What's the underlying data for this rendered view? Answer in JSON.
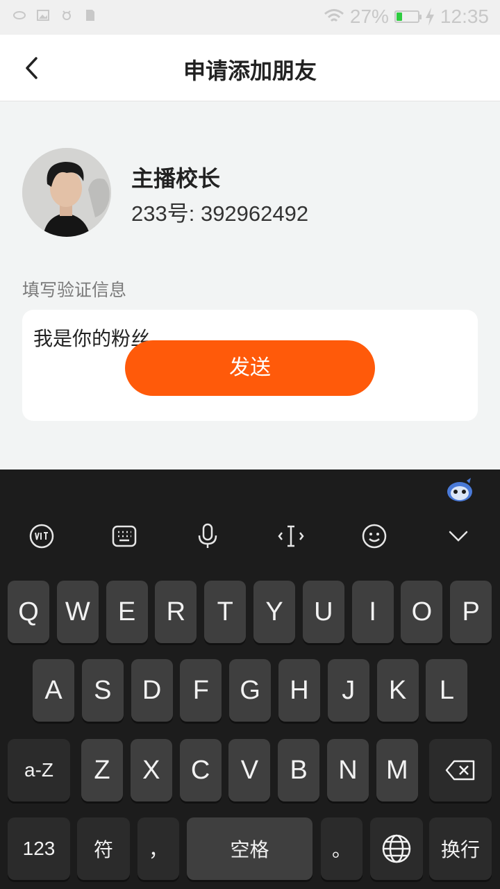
{
  "status_bar": {
    "battery": "27%",
    "battery_level": 0.27,
    "time": "12:35"
  },
  "header": {
    "title": "申请添加朋友"
  },
  "profile": {
    "name": "主播校长",
    "id_label": "233号: ",
    "id_value": "392962492"
  },
  "verification": {
    "label": "填写验证信息",
    "message": "我是你的粉丝",
    "send_label": "发送"
  },
  "keyboard": {
    "row1": [
      "Q",
      "W",
      "E",
      "R",
      "T",
      "Y",
      "U",
      "I",
      "O",
      "P"
    ],
    "row2": [
      "A",
      "S",
      "D",
      "F",
      "G",
      "H",
      "J",
      "K",
      "L"
    ],
    "row3": [
      "Z",
      "X",
      "C",
      "V",
      "B",
      "N",
      "M"
    ],
    "case_key": "a-Z",
    "num_key": "123",
    "symbol_key": "符",
    "comma_key": "，",
    "space_key": "空格",
    "period_key": "。",
    "enter_key": "换行",
    "toolbar_icons": [
      "handwriting-icon",
      "keyboard-layout-icon",
      "microphone-icon",
      "cursor-icon",
      "emoji-icon",
      "collapse-keyboard-icon"
    ]
  },
  "colors": {
    "accent": "#ff5a0a",
    "keyboard_bg": "#1c1c1c",
    "key_bg": "#3f3f3f"
  }
}
